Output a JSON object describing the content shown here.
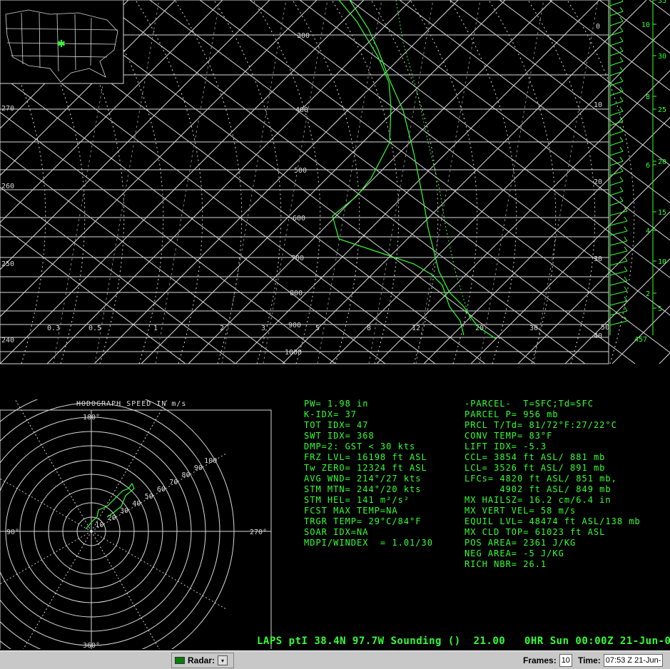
{
  "skewt": {
    "pressure_labels": [
      "300",
      "400",
      "500",
      "600",
      "700",
      "800",
      "900",
      "1000"
    ],
    "mixing_ratio_labels": [
      "0.3",
      "0.5",
      "1",
      "2",
      "3",
      "5",
      "8",
      "12",
      "20",
      "30"
    ],
    "temp_labels": [
      "0",
      "10",
      "20",
      "30",
      "40",
      "50"
    ],
    "theta_labels_left": [
      "270",
      "260",
      "250",
      "240"
    ],
    "right_axis_km": [
      "10",
      "8",
      "6",
      "4",
      "2"
    ],
    "right_axis_kft": [
      "35",
      "30",
      "25",
      "20",
      "15",
      "10",
      "5"
    ],
    "station_elev": "457",
    "map_station_marker": "✱"
  },
  "hodograph": {
    "title": "HODOGRAPH SPEED IN m/s",
    "dir_top": "180°",
    "dir_left": "90°",
    "dir_right": "270°",
    "dir_bottom": "360°",
    "ring_labels": [
      "10",
      "20",
      "30",
      "40",
      "50",
      "60",
      "70",
      "80",
      "90",
      "100"
    ]
  },
  "indices_left": [
    "PW= 1.98 in",
    "K-IDX= 37",
    "TOT IDX= 47",
    "SWT IDX= 368",
    "DMP=2: GST < 30 kts",
    "FRZ LVL= 16198 ft ASL",
    "Tw ZERO= 12324 ft ASL",
    "AVG WND= 214°/27 kts",
    "STM MTN= 244°/20 kts",
    "STM HEL= 141 m²/s²",
    "FCST MAX TEMP=NA",
    "TRGR TEMP= 29°C/84°F",
    "SOAR IDX=NA",
    "MDPI/WINDEX  = 1.01/30"
  ],
  "indices_right": [
    "-PARCEL-  T=SFC;Td=SFC",
    "PARCEL P= 956 mb",
    "PRCL T/Td= 81/72°F:27/22°C",
    "CONV TEMP= 83°F",
    "LIFT IDX= -5.3",
    "CCL= 3854 ft ASL/ 881 mb",
    "LCL= 3526 ft ASL/ 891 mb",
    "LFCs= 4820 ft ASL/ 851 mb,",
    "      4902 ft ASL/ 849 mb",
    "MX HAILSZ= 16.2 cm/6.4 in",
    "MX VERT VEL= 58 m/s",
    "EQUIL LVL= 48474 ft ASL/138 mb",
    "MX CLD TOP= 61023 ft ASL",
    "POS AREA= 2361 J/KG",
    "NEG AREA= -5 J/KG",
    "RICH NBR= 26.1"
  ],
  "title_line": "LAPS ptI 38.4N 97.7W Sounding ()  21.00   0HR Sun 00:00Z 21-Jun-0",
  "statusbar": {
    "radar_label": "Radar:",
    "frames_label": "Frames:",
    "frames_value": "10",
    "time_label": "Time:",
    "time_value": "07:53 Z 21-Jun-"
  },
  "colors": {
    "profile": "#33ff33",
    "grid": "#d8d8d8",
    "background": "#000000"
  }
}
